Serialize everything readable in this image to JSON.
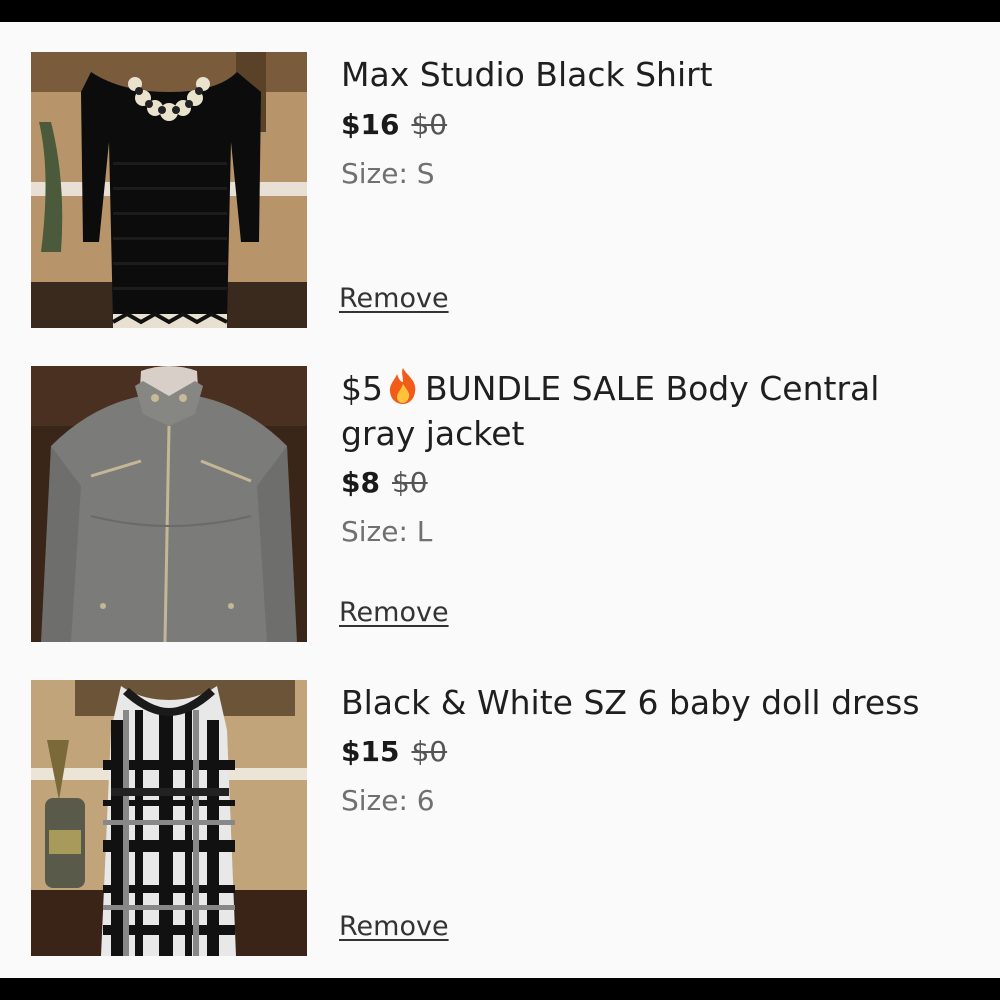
{
  "cart": {
    "items": [
      {
        "title": "Max Studio Black Shirt",
        "title_prefix": "",
        "title_suffix": "",
        "price": "$16",
        "original_price": "$0",
        "size": "Size: S",
        "remove_label": "Remove",
        "image_icon": "black-shirt-photo"
      },
      {
        "title": "",
        "title_prefix": "$5",
        "title_suffix": "BUNDLE SALE Body Central gray jacket",
        "price": "$8",
        "original_price": "$0",
        "size": "Size: L",
        "remove_label": "Remove",
        "image_icon": "gray-jacket-photo",
        "emoji_icon": "fire-icon"
      },
      {
        "title": "Black & White SZ 6 baby doll dress",
        "title_prefix": "",
        "title_suffix": "",
        "price": "$15",
        "original_price": "$0",
        "size": "Size: 6",
        "remove_label": "Remove",
        "image_icon": "plaid-dress-photo"
      }
    ]
  },
  "colors": {
    "background": "#fafafa",
    "frame": "#000000",
    "text": "#1f1f1f",
    "muted": "#707070"
  }
}
